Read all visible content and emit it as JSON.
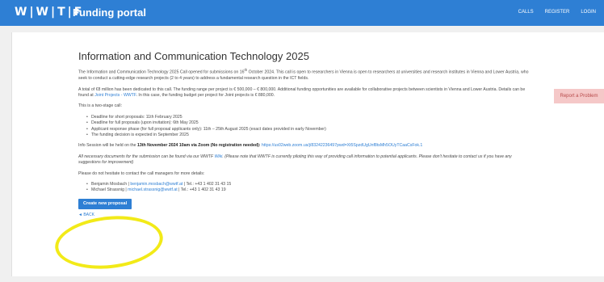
{
  "header": {
    "logo": "W|W|T|F",
    "title": "Funding portal",
    "nav": [
      "CALLS",
      "REGISTER",
      "LOGIN"
    ]
  },
  "main": {
    "title": "Information and Communication Technology 2025",
    "p1_a": "The Information and Communication Technology 2025 Call opened for submissions on 16",
    "p1_sup": "th",
    "p1_b": " October 2024. This call is open to researchers in Vienna is open to researchers at universities and research institutes in Vienna and Lower Austria, who seek to conduct a cutting-edge research projects (2 to 4 years) to address a fundamental research question in the ICT fields.",
    "p2_a": "A total of €8 million has been dedicated to this call. The funding range per project is € 500,000 – € 800,000. Additional funding opportunities are available for collaborative projects between scientists in Vienna and Lower Austria. Details can be found at ",
    "p2_link": "Joint Projects - WWTF",
    "p2_b": ". In this case, the funding budget per project for Joint projects is € 880,000.",
    "p3": "This is a two-stage call:",
    "deadlines": [
      "Deadline for short proposals: 11th February 2025",
      "Deadline for full proposals (upon invitation): 6th May 2025",
      "Applicant response phase (for full proposal applicants only): 11th – 25th August 2025 (exact dates provided in early November)",
      "The funding decision is expected in September 2025"
    ],
    "info_a": "Info Session will be held on the ",
    "info_b": "13th November 2024 10am via Zoom (No registration needed): ",
    "info_link": "https://us02web.zoom.us/j/83242236497pwd=Xt5SpzdUgUnf8tsMh5OUyTCaaCsFok.1",
    "docs_a": "All necessary documents for the submission can be found via our WWTF ",
    "docs_link": "Wiki",
    "docs_b": ". (Please note that WWTF is currently piloting this way of providing call information to potential applicants. Please don't hesitate to contact us if you have any suggestions for improvement)",
    "contact_intro": "Please do not hesitate to contact the call managers for more details:",
    "contacts": [
      {
        "name": "Benjamin Mosbach | ",
        "email": "benjamin.mosbach@wwtf.at",
        "tel": " | Tel.: +43 1 402 31 43 15"
      },
      {
        "name": "Michael Strassnig | ",
        "email": "michael.strassnig@wwtf.at",
        "tel": " | Tel.: +43 1 402 31 43 19"
      }
    ],
    "create_button": "Create new proposal",
    "back_link": "◄ BACK"
  },
  "report_button": "Report a Problem",
  "highlight_color": "#f2ea18",
  "accent_color": "#2e7fd4"
}
